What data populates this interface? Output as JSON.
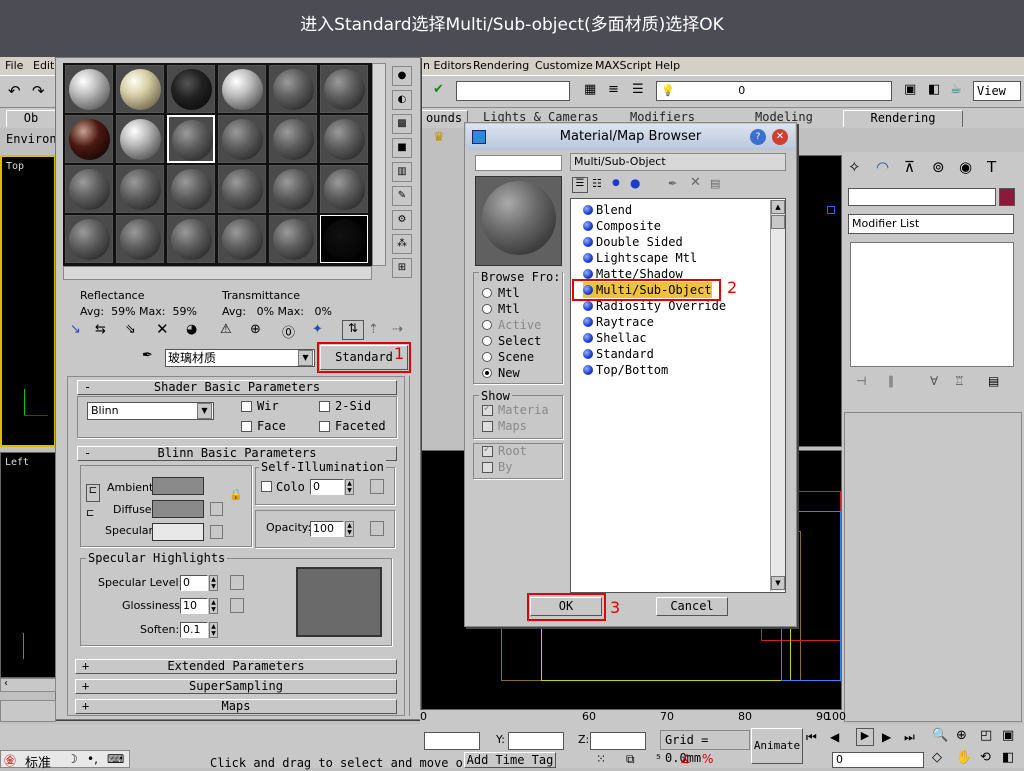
{
  "banner": {
    "text": "进入Standard选择Multi/Sub-object(多面材质)选择OK"
  },
  "menu": {
    "file": "File",
    "edit": "Edit",
    "editors": "n Editors",
    "rendering": "Rendering",
    "customize": "Customize",
    "maxscript": "MAXScript",
    "help": "Help"
  },
  "toolbar": {
    "view_label": "View",
    "layer_value": "0"
  },
  "tabs": {
    "objects": "Ob",
    "bounds": "ounds",
    "lights": "Lights & Cameras",
    "modifiers": "Modifiers",
    "modeling": "Modeling",
    "rendering": "Rendering",
    "environment": "Environ"
  },
  "viewports": {
    "top": "Top",
    "left": "Left"
  },
  "command_panel": {
    "modifier_list": "Modifier List",
    "accent_color": "#8b1a3a"
  },
  "material_editor": {
    "reflectance_label": "Reflectance",
    "reflectance_values": "Avg:  59% Max:  59%",
    "transmittance_label": "Transmittance",
    "transmittance_values": "Avg:   0% Max:   0%",
    "material_name": "玻璃材质",
    "type_button": "Standard",
    "shader_rollout": "Shader Basic Parameters",
    "shader_value": "Blinn",
    "wire": "Wir",
    "two_sided": "2-Sid",
    "face": "Face",
    "faceted": "Faceted",
    "blinn_rollout": "Blinn Basic Parameters",
    "self_illum": "Self-Illumination",
    "color": "Colo",
    "color_value": "0",
    "ambient": "Ambient:",
    "diffuse": "Diffuse:",
    "specular": "Specular:",
    "opacity": "Opacity:",
    "opacity_value": "100",
    "spec_highlights": "Specular Highlights",
    "spec_level": "Specular Level:",
    "spec_level_value": "0",
    "glossiness": "Glossiness:",
    "glossiness_value": "10",
    "soften": "Soften:",
    "soften_value": "0.1",
    "extended": "Extended Parameters",
    "supersampling": "SuperSampling",
    "maps": "Maps"
  },
  "browser": {
    "title": "Material/Map Browser",
    "selected_name": "Multi/Sub-Object",
    "browse_from": "Browse Fro:",
    "browse_options": [
      "Mtl",
      "Mtl",
      "Active",
      "Select",
      "Scene",
      "New"
    ],
    "show": "Show",
    "show_options": [
      "Materia",
      "Maps"
    ],
    "root": "Root",
    "by": "By",
    "items": [
      "Blend",
      "Composite",
      "Double Sided",
      "Lightscape Mtl",
      "Matte/Shadow",
      "Multi/Sub-Object",
      "Radiosity Override",
      "Raytrace",
      "Shellac",
      "Standard",
      "Top/Bottom"
    ],
    "ok": "OK",
    "cancel": "Cancel"
  },
  "annotations": {
    "one": "1",
    "two": "2",
    "three": "3"
  },
  "status": {
    "grid": "Grid = 0.0mm",
    "animate": "Animate",
    "y_label": "Y:",
    "z_label": "Z:",
    "hint": "Click and drag to select and move o",
    "add_time_tag": "Add Time Tag",
    "frame": "0",
    "ime": "标准"
  },
  "ruler": [
    "0",
    "60",
    "70",
    "80",
    "90",
    "100"
  ]
}
